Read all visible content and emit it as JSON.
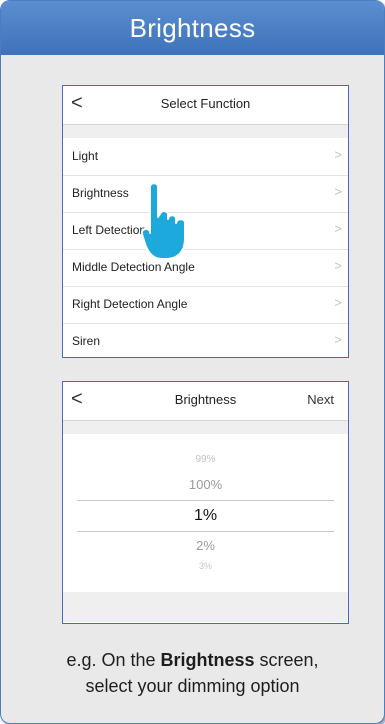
{
  "banner": {
    "title": "Brightness"
  },
  "select_function": {
    "back_icon": "<",
    "title": "Select Function",
    "items": [
      {
        "label": "Light"
      },
      {
        "label": "Brightness"
      },
      {
        "label": "Left Detection Angle"
      },
      {
        "label": "Middle Detection Angle"
      },
      {
        "label": "Right Detection Angle"
      },
      {
        "label": "Siren"
      }
    ],
    "chevron": ">"
  },
  "brightness_screen": {
    "back_icon": "<",
    "title": "Brightness",
    "next_label": "Next",
    "options": [
      "99%",
      "100%",
      "1%",
      "2%",
      "3%"
    ],
    "selected": "1%"
  },
  "caption": {
    "line1_prefix": "e.g. On the ",
    "line1_bold": "Brightness",
    "line1_suffix": " screen,",
    "line2": "select your dimming option"
  },
  "colors": {
    "banner": "#4a80c6",
    "hand": "#1da9dc",
    "panel_border": "#3d6fbf"
  },
  "icons": {
    "hand": "pointing-hand-icon"
  }
}
